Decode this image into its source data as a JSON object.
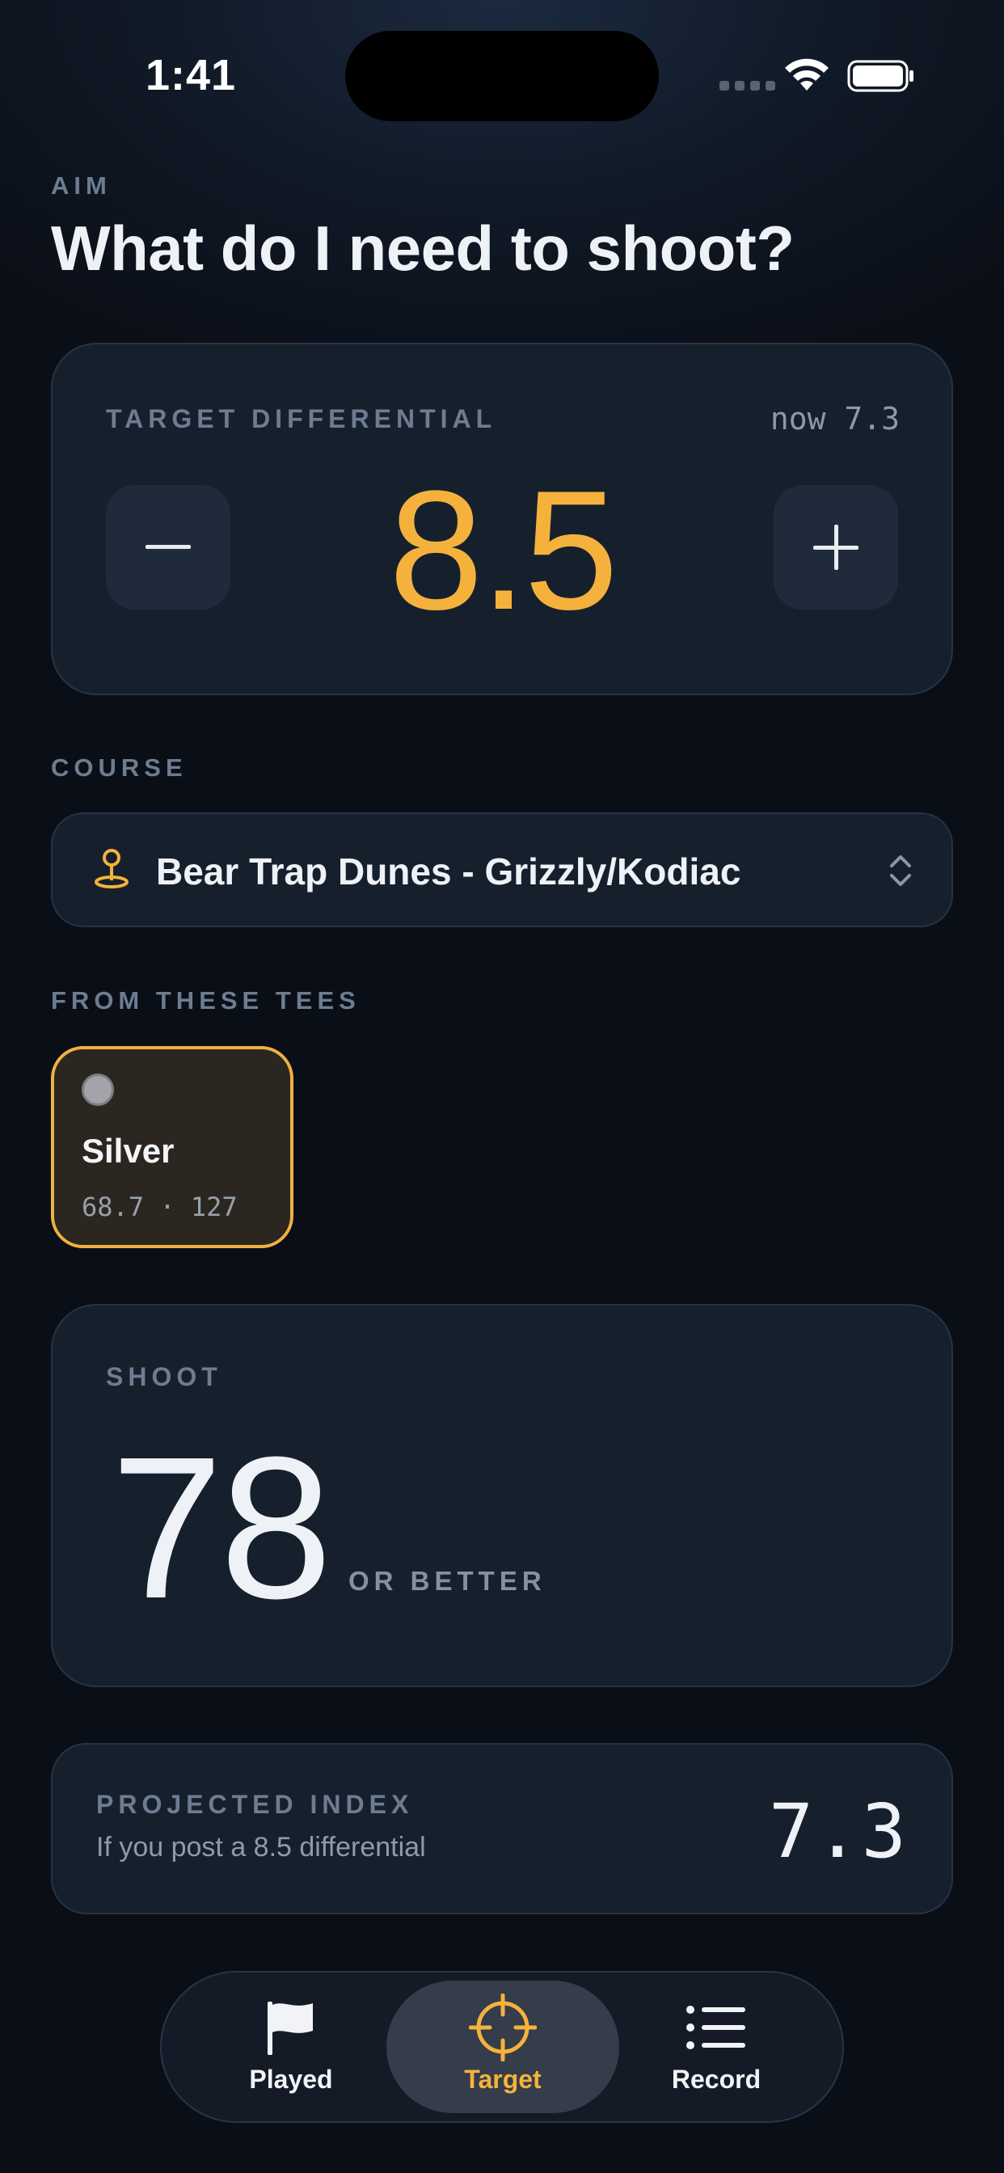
{
  "status": {
    "time": "1:41"
  },
  "header": {
    "eyebrow": "AIM",
    "title": "What do I need to shoot?"
  },
  "target": {
    "label": "TARGET DIFFERENTIAL",
    "now": "now 7.3",
    "value": "8.5",
    "decrement_label": "−",
    "increment_label": "+"
  },
  "course": {
    "section_label": "COURSE",
    "name": "Bear Trap Dunes - Grizzly/Kodiac"
  },
  "tees": {
    "section_label": "FROM THESE TEES",
    "items": [
      {
        "name": "Silver",
        "stats": "68.7 · 127",
        "color": "#a2a4a9",
        "selected": true
      }
    ]
  },
  "shoot": {
    "label": "SHOOT",
    "value": "78",
    "suffix": "OR BETTER"
  },
  "projected": {
    "label": "PROJECTED INDEX",
    "subtitle": "If you post a 8.5 differential",
    "value": "7.3"
  },
  "tabs": [
    {
      "label": "Played",
      "icon": "flag-icon",
      "active": false
    },
    {
      "label": "Target",
      "icon": "crosshair-icon",
      "active": true
    },
    {
      "label": "Record",
      "icon": "list-icon",
      "active": false
    }
  ],
  "colors": {
    "accent": "#f4b23d",
    "card": "#16202d",
    "background": "#0a0e16"
  }
}
